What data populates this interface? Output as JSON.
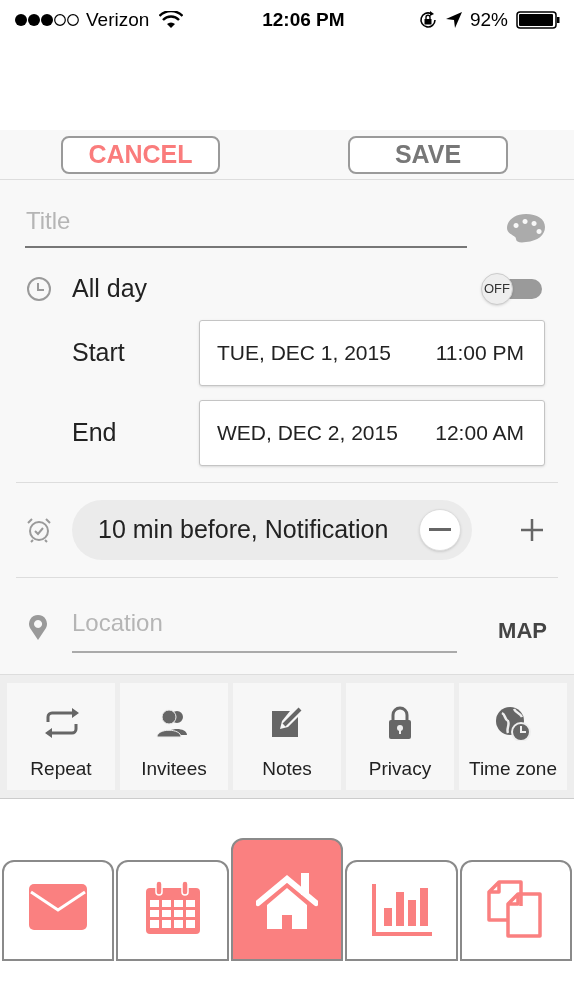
{
  "status_bar": {
    "carrier": "Verizon",
    "time": "12:06 PM",
    "battery": "92%"
  },
  "header": {
    "cancel": "CANCEL",
    "save": "SAVE"
  },
  "title_field": {
    "placeholder": "Title"
  },
  "all_day": {
    "label": "All day",
    "toggle": "OFF",
    "on": false
  },
  "start": {
    "label": "Start",
    "date": "TUE, DEC 1, 2015",
    "time": "11:00 PM"
  },
  "end": {
    "label": "End",
    "date": "WED, DEC 2, 2015",
    "time": "12:00 AM"
  },
  "reminder": {
    "text": "10 min before, Notification"
  },
  "location": {
    "placeholder": "Location",
    "map": "MAP"
  },
  "options": [
    {
      "kind": "repeat",
      "label": "Repeat"
    },
    {
      "kind": "invitees",
      "label": "Invitees"
    },
    {
      "kind": "notes",
      "label": "Notes"
    },
    {
      "kind": "privacy",
      "label": "Privacy"
    },
    {
      "kind": "timezone",
      "label": "Time zone"
    }
  ],
  "tabs": [
    {
      "kind": "mail",
      "selected": false
    },
    {
      "kind": "calendar",
      "selected": false
    },
    {
      "kind": "home",
      "selected": true
    },
    {
      "kind": "chart",
      "selected": false
    },
    {
      "kind": "copy",
      "selected": false
    }
  ]
}
